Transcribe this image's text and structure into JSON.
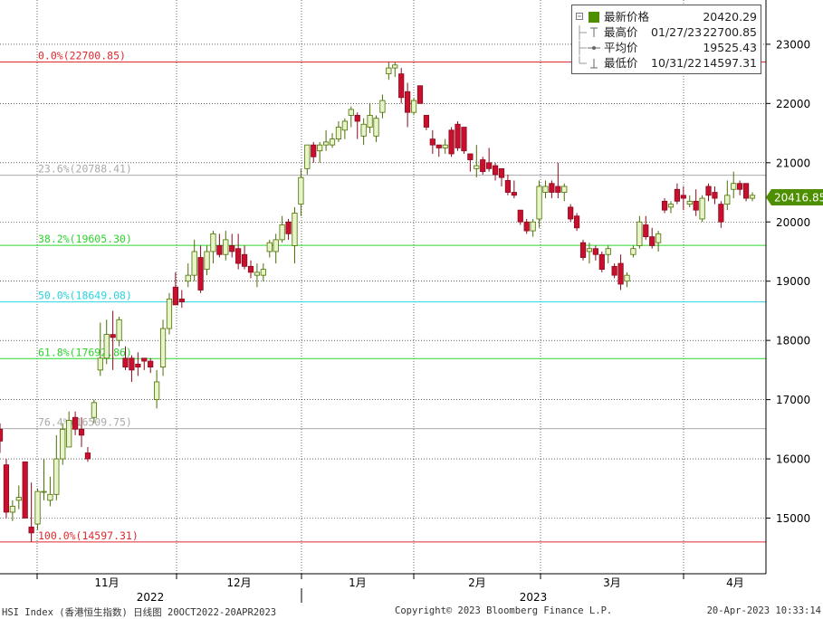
{
  "chart_data": {
    "type": "candlestick",
    "title": "",
    "ylim": [
      14000,
      23700
    ],
    "y_ticks": [
      15000,
      16000,
      17000,
      18000,
      19000,
      20000,
      21000,
      22000,
      23000
    ],
    "x_month_labels": [
      "11月",
      "12月",
      "1月",
      "2月",
      "3月",
      "4月"
    ],
    "x_year_labels": [
      "2022",
      "2023"
    ],
    "last_price_label": "20416.85",
    "grid": true,
    "legend_position": "top-right",
    "fib_levels": [
      {
        "label": "0.0%(22700.85)",
        "value": 22700.85,
        "color": "#e0282f"
      },
      {
        "label": "23.6%(20788.41)",
        "value": 20788.41,
        "color": "#aaaaaa"
      },
      {
        "label": "38.2%(19605.30)",
        "value": 19605.3,
        "color": "#2bd52b"
      },
      {
        "label": "50.0%(18649.08)",
        "value": 18649.08,
        "color": "#29d4de"
      },
      {
        "label": "61.8%(17692.86)",
        "value": 17692.86,
        "color": "#2bd52b"
      },
      {
        "label": "76.4%(16509.75)",
        "value": 16509.75,
        "color": "#aaaaaa"
      },
      {
        "label": "100.0%(14597.31)",
        "value": 14597.31,
        "color": "#e0282f"
      }
    ],
    "candles": [
      [
        16500,
        16600,
        16100,
        16300
      ],
      [
        15900,
        16000,
        15000,
        15100
      ],
      [
        15100,
        15300,
        14950,
        15200
      ],
      [
        15300,
        15550,
        15150,
        15350
      ],
      [
        15950,
        15950,
        15100,
        15000
      ],
      [
        14850,
        15600,
        14600,
        14750
      ],
      [
        14900,
        15500,
        14800,
        15450
      ],
      [
        15450,
        16000,
        15300,
        15450
      ],
      [
        15300,
        15700,
        15200,
        15400
      ],
      [
        15400,
        16400,
        15300,
        16000
      ],
      [
        16000,
        16600,
        15900,
        16500
      ],
      [
        16200,
        16800,
        16200,
        16650
      ],
      [
        16700,
        16800,
        16400,
        16500
      ],
      [
        16500,
        16700,
        16200,
        16400
      ],
      [
        16100,
        16200,
        15950,
        16000
      ],
      [
        16700,
        17000,
        16600,
        16950
      ],
      [
        17500,
        18300,
        17400,
        17700
      ],
      [
        17700,
        18350,
        17600,
        18100
      ],
      [
        18100,
        18500,
        17500,
        18050
      ],
      [
        18000,
        18400,
        17900,
        18350
      ],
      [
        17700,
        17900,
        17500,
        17550
      ],
      [
        17700,
        17750,
        17300,
        17500
      ],
      [
        17600,
        17800,
        17400,
        17550
      ],
      [
        17700,
        17700,
        17500,
        17650
      ],
      [
        17650,
        17700,
        17450,
        17550
      ],
      [
        17000,
        17500,
        16850,
        17300
      ],
      [
        17550,
        18350,
        17400,
        18200
      ],
      [
        18200,
        18800,
        18100,
        18700
      ],
      [
        18900,
        19150,
        18600,
        18600
      ],
      [
        18700,
        18850,
        18550,
        18650
      ],
      [
        19000,
        19300,
        18900,
        19100
      ],
      [
        19100,
        19700,
        19000,
        19500
      ],
      [
        19400,
        19600,
        18800,
        18850
      ],
      [
        19200,
        19600,
        19100,
        19500
      ],
      [
        19500,
        19850,
        19300,
        19800
      ],
      [
        19600,
        19800,
        19400,
        19450
      ],
      [
        19450,
        19850,
        19350,
        19700
      ],
      [
        19600,
        19800,
        19400,
        19500
      ],
      [
        19550,
        19800,
        19200,
        19300
      ],
      [
        19450,
        19600,
        19200,
        19250
      ],
      [
        19250,
        19350,
        19050,
        19150
      ],
      [
        19100,
        19300,
        18900,
        19150
      ],
      [
        19100,
        19300,
        19000,
        19200
      ],
      [
        19500,
        19700,
        19400,
        19650
      ],
      [
        19500,
        19800,
        19300,
        19700
      ],
      [
        19700,
        20100,
        19650,
        19950
      ],
      [
        20000,
        20050,
        19700,
        19800
      ],
      [
        19600,
        20250,
        19300,
        20150
      ],
      [
        20300,
        20900,
        20100,
        20750
      ],
      [
        20900,
        21300,
        20800,
        21300
      ],
      [
        21300,
        21350,
        21000,
        21100
      ],
      [
        21200,
        21350,
        21000,
        21300
      ],
      [
        21300,
        21550,
        21200,
        21350
      ],
      [
        21300,
        21500,
        21250,
        21400
      ],
      [
        21400,
        21700,
        21350,
        21600
      ],
      [
        21550,
        21750,
        21400,
        21700
      ],
      [
        21800,
        21950,
        21600,
        21900
      ],
      [
        21800,
        21850,
        21400,
        21700
      ],
      [
        21450,
        21750,
        21300,
        21650
      ],
      [
        21600,
        22000,
        21500,
        21800
      ],
      [
        21450,
        21800,
        21350,
        21750
      ],
      [
        21850,
        22150,
        21750,
        22050
      ],
      [
        22500,
        22700,
        22400,
        22600
      ],
      [
        22600,
        22700,
        22450,
        22650
      ],
      [
        22500,
        22600,
        22000,
        22100
      ],
      [
        22200,
        22350,
        21600,
        21850
      ],
      [
        21850,
        22100,
        21800,
        22050
      ],
      [
        22300,
        22300,
        22000,
        22000
      ],
      [
        21800,
        21800,
        21550,
        21600
      ],
      [
        21400,
        21550,
        21150,
        21300
      ],
      [
        21300,
        21300,
        21100,
        21250
      ],
      [
        21250,
        21400,
        21150,
        21300
      ],
      [
        21550,
        21600,
        21100,
        21150
      ],
      [
        21650,
        21700,
        21200,
        21250
      ],
      [
        21600,
        21600,
        21150,
        21200
      ],
      [
        21150,
        21150,
        20850,
        21050
      ],
      [
        20900,
        21300,
        20750,
        20950
      ],
      [
        21050,
        21100,
        20800,
        20850
      ],
      [
        21000,
        21250,
        20850,
        20900
      ],
      [
        20950,
        21000,
        20700,
        20800
      ],
      [
        20900,
        20900,
        20600,
        20750
      ],
      [
        20700,
        20800,
        20450,
        20500
      ],
      [
        20500,
        20700,
        20400,
        20450
      ],
      [
        20200,
        20200,
        19950,
        20000
      ],
      [
        20000,
        20050,
        19800,
        19850
      ],
      [
        19850,
        20050,
        19750,
        20000
      ],
      [
        20050,
        20700,
        19900,
        20600
      ],
      [
        20500,
        20700,
        20400,
        20600
      ],
      [
        20650,
        20700,
        20400,
        20500
      ],
      [
        20600,
        21000,
        20400,
        20500
      ],
      [
        20500,
        20650,
        20350,
        20600
      ],
      [
        20250,
        20300,
        20000,
        20050
      ],
      [
        20100,
        20150,
        19850,
        19900
      ],
      [
        19650,
        19700,
        19350,
        19400
      ],
      [
        19500,
        19650,
        19300,
        19550
      ],
      [
        19550,
        19600,
        19350,
        19450
      ],
      [
        19450,
        19500,
        19150,
        19200
      ],
      [
        19450,
        19600,
        19300,
        19550
      ],
      [
        19250,
        19300,
        19050,
        19100
      ],
      [
        19300,
        19450,
        18850,
        18950
      ],
      [
        19000,
        19150,
        18900,
        19100
      ],
      [
        19450,
        19600,
        19400,
        19550
      ],
      [
        19600,
        20100,
        19550,
        20000
      ],
      [
        19950,
        20100,
        19700,
        19750
      ],
      [
        19750,
        19900,
        19550,
        19600
      ],
      [
        19650,
        19850,
        19500,
        19800
      ],
      [
        20350,
        20400,
        20150,
        20200
      ],
      [
        20250,
        20350,
        20150,
        20300
      ],
      [
        20550,
        20650,
        20300,
        20350
      ],
      [
        20450,
        20600,
        20200,
        20400
      ],
      [
        20300,
        20450,
        20250,
        20350
      ],
      [
        20350,
        20550,
        20100,
        20200
      ],
      [
        20050,
        20450,
        20000,
        20400
      ],
      [
        20600,
        20650,
        20350,
        20450
      ],
      [
        20500,
        20600,
        20300,
        20400
      ],
      [
        20300,
        20350,
        19900,
        20000
      ],
      [
        20300,
        20700,
        20200,
        20450
      ],
      [
        20550,
        20850,
        20400,
        20650
      ],
      [
        20650,
        20700,
        20450,
        20550
      ],
      [
        20650,
        20650,
        20350,
        20400
      ],
      [
        20400,
        20500,
        20350,
        20450
      ]
    ],
    "legend": [
      {
        "label": "最新价格",
        "date": "",
        "value": "20420.29",
        "symbol": "square"
      },
      {
        "label": "最高价",
        "date": "01/27/23",
        "value": "22700.85",
        "symbol": "top"
      },
      {
        "label": "平均价",
        "date": "",
        "value": "19525.43",
        "symbol": "avg"
      },
      {
        "label": "最低价",
        "date": "10/31/22",
        "value": "14597.31",
        "symbol": "bottom"
      }
    ]
  },
  "footer": {
    "left": "HSI Index (香港恒生指数) 日线图 20OCT2022-20APR2023",
    "center": "Copyright© 2023 Bloomberg Finance L.P.",
    "right": "20-Apr-2023 10:33:14"
  },
  "colors": {
    "up": "#e8f5c8",
    "up_edge": "#4a6f00",
    "down": "#c8102e",
    "down_edge": "#8a0a1e",
    "grid": "#000000",
    "last_price_bg": "#4e8f00"
  }
}
